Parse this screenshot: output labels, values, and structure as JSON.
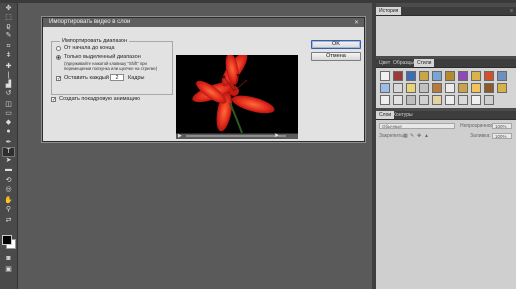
{
  "dialog": {
    "title": "Импортировать видео в слои",
    "range_group_label": "Импортировать диапазон",
    "option_full": "От начала до конца",
    "option_selected": "Только выделенный диапазон",
    "hint_line1": "(Удерживайте нажатой клавишу \"Shift\" при",
    "hint_line2": "перемещении ползунка или щелчке на стрелке)",
    "every_label": "Оставить каждый",
    "every_value": "2",
    "frames_label": "Кадры",
    "animation_label": "Создать покадровую анимацию",
    "ok_label": "OK",
    "cancel_label": "Отмена"
  },
  "panels": {
    "history_tab": "История",
    "swatches_tabs": [
      "Цвет",
      "Образцы",
      "Стили"
    ],
    "layers_tabs": [
      "Слои",
      "Контуры"
    ],
    "blend_mode": "Обычные",
    "opacity_label": "Непрозрачность:",
    "opacity_value": "100%",
    "lock_label": "Закрепить:",
    "fill_label": "Заливка:",
    "fill_value": "100%"
  },
  "colors": {
    "foreground": "#000000",
    "background": "#ffffff",
    "accent": "#3b5ea8"
  }
}
